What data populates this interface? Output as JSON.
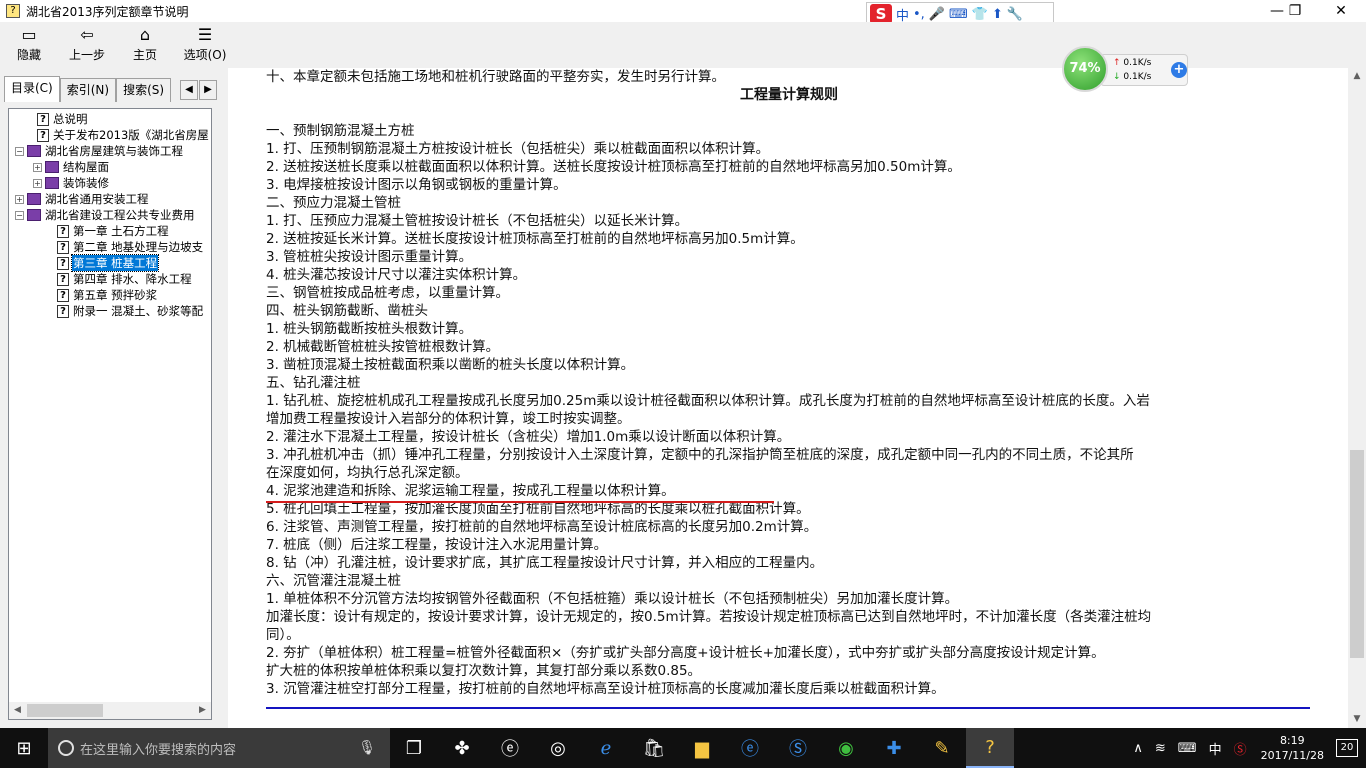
{
  "window": {
    "title": "湖北省2013序列定额章节说明",
    "controls": {
      "minimize": "—",
      "maximize": "❐",
      "close": "✕"
    }
  },
  "ime": {
    "logo": "S",
    "lang": "中",
    "items": [
      "•,",
      "🎤",
      "⌨",
      "👕",
      "⬆",
      "🔧"
    ]
  },
  "toolbar": [
    {
      "name": "hide",
      "label": "隐藏",
      "icon": "▭"
    },
    {
      "name": "back",
      "label": "上一步",
      "icon": "⇦"
    },
    {
      "name": "home",
      "label": "主页",
      "icon": "⌂"
    },
    {
      "name": "options",
      "label": "选项(O)",
      "icon": "☰"
    }
  ],
  "tabs": [
    {
      "label": "目录(C)",
      "active": true
    },
    {
      "label": "索引(N)",
      "active": false
    },
    {
      "label": "搜索(S)",
      "active": false
    }
  ],
  "tree": [
    {
      "level": 0,
      "type": "page",
      "exp": "",
      "label": "总说明"
    },
    {
      "level": 0,
      "type": "page",
      "exp": "",
      "label": "关于发布2013版《湖北省房屋"
    },
    {
      "level": 0,
      "type": "book",
      "exp": "−",
      "label": "湖北省房屋建筑与装饰工程"
    },
    {
      "level": 1,
      "type": "book",
      "exp": "+",
      "label": "结构屋面"
    },
    {
      "level": 1,
      "type": "book",
      "exp": "+",
      "label": "装饰装修"
    },
    {
      "level": 0,
      "type": "book",
      "exp": "+",
      "label": "湖北省通用安装工程"
    },
    {
      "level": 0,
      "type": "book",
      "exp": "−",
      "label": "湖北省建设工程公共专业费用"
    },
    {
      "level": 1,
      "type": "page",
      "exp": "",
      "label": "第一章  土石方工程"
    },
    {
      "level": 1,
      "type": "page",
      "exp": "",
      "label": "第二章  地基处理与边坡支"
    },
    {
      "level": 1,
      "type": "page",
      "exp": "",
      "label": "第三章  桩基工程",
      "selected": true
    },
    {
      "level": 1,
      "type": "page",
      "exp": "",
      "label": "第四章  排水、降水工程"
    },
    {
      "level": 1,
      "type": "page",
      "exp": "",
      "label": "第五章  预拌砂浆"
    },
    {
      "level": 1,
      "type": "page",
      "exp": "",
      "label": "附录一  混凝土、砂浆等配"
    }
  ],
  "network": {
    "percent": "74%",
    "up": "0.1K/s",
    "down": "0.1K/s"
  },
  "document": {
    "top_line": "十、本章定额未包括施工场地和桩机行驶路面的平整夯实，发生时另行计算。",
    "heading": "工程量计算规则",
    "lines": [
      "一、预制钢筋混凝土方桩",
      "1. 打、压预制钢筋混凝土方桩按设计桩长（包括桩尖）乘以桩截面面积以体积计算。",
      "2. 送桩按送桩长度乘以桩截面面积以体积计算。送桩长度按设计桩顶标高至打桩前的自然地坪标高另加0.50m计算。",
      "3. 电焊接桩按设计图示以角钢或钢板的重量计算。",
      "二、预应力混凝土管桩",
      "1. 打、压预应力混凝土管桩按设计桩长（不包括桩尖）以延长米计算。",
      "2. 送桩按延长米计算。送桩长度按设计桩顶标高至打桩前的自然地坪标高另加0.5m计算。",
      "3. 管桩桩尖按设计图示重量计算。",
      "4. 桩头灌芯按设计尺寸以灌注实体积计算。",
      "三、钢管桩按成品桩考虑，以重量计算。",
      "四、桩头钢筋截断、凿桩头",
      "1. 桩头钢筋截断按桩头根数计算。",
      "2. 机械截断管桩桩头按管桩根数计算。",
      "3. 凿桩顶混凝土按桩截面积乘以凿断的桩头长度以体积计算。",
      "五、钻孔灌注桩",
      "1. 钻孔桩、旋挖桩机成孔工程量按成孔长度另加0.25m乘以设计桩径截面积以体积计算。成孔长度为打桩前的自然地坪标高至设计桩底的长度。入岩",
      "增加费工程量按设计入岩部分的体积计算，竣工时按实调整。",
      "2. 灌注水下混凝土工程量，按设计桩长（含桩尖）增加1.0m乘以设计断面以体积计算。",
      "3. 冲孔桩机冲击（抓）锤冲孔工程量，分别按设计入土深度计算，定额中的孔深指护筒至桩底的深度，成孔定额中同一孔内的不同土质，不论其所",
      "在深度如何，均执行总孔深定额。",
      "4. 泥浆池建造和拆除、泥浆运输工程量，按成孔工程量以体积计算。",
      "5. 桩孔回填土工程量，按加灌长度顶面至打桩前自然地坪标高的长度乘以桩孔截面积计算。",
      "6. 注浆管、声测管工程量，按打桩前的自然地坪标高至设计桩底标高的长度另加0.2m计算。",
      "7. 桩底（侧）后注浆工程量，按设计注入水泥用量计算。",
      "8. 钻（冲）孔灌注桩，设计要求扩底，其扩底工程量按设计尺寸计算，并入相应的工程量内。",
      "六、沉管灌注混凝土桩",
      "1. 单桩体积不分沉管方法均按钢管外径截面积（不包括桩箍）乘以设计桩长（不包括预制桩尖）另加加灌长度计算。",
      "加灌长度：设计有规定的，按设计要求计算，设计无规定的，按0.5m计算。若按设计规定桩顶标高已达到自然地坪时，不计加灌长度（各类灌注桩均",
      "同）。",
      "2. 夯扩（单桩体积）桩工程量=桩管外径截面积×（夯扩或扩头部分高度+设计桩长+加灌长度），式中夯扩或扩头部分高度按设计规定计算。",
      "扩大桩的体积按单桩体积乘以复打次数计算，其复打部分乘以系数0.85。",
      "3. 沉管灌注桩空打部分工程量，按打桩前的自然地坪标高至设计桩顶标高的长度减加灌长度后乘以桩截面积计算。"
    ],
    "underlined_line_index": 20
  },
  "taskbar": {
    "search_placeholder": "在这里输入你要搜索的内容",
    "apps": [
      "task-view",
      "pinwheel",
      "browser-e",
      "swirl",
      "edge",
      "store",
      "explorer",
      "ie",
      "sogou-browser",
      "360-browser",
      "plus-app",
      "notepad",
      "help-viewer"
    ],
    "tray_lang": "中",
    "time": "8:19",
    "date": "2017/11/28",
    "notifications": "20"
  },
  "colors": {
    "selection": "#0078d7",
    "red_underline": "#d41c1c",
    "blue_rule": "#1414c0"
  }
}
